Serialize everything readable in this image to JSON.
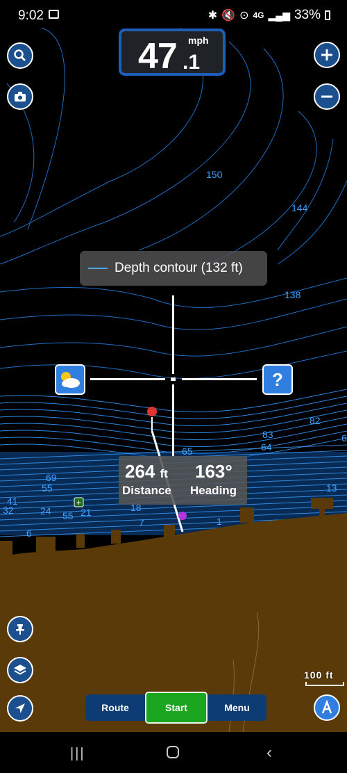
{
  "status": {
    "time": "9:02",
    "battery": "33%",
    "network": "4G",
    "icons": [
      "image-icon",
      "bluetooth-icon",
      "mute-icon",
      "location-icon",
      "signal-icon",
      "battery-icon"
    ]
  },
  "speedometer": {
    "integer": "47",
    "decimal": ".1",
    "unit": "mph"
  },
  "map_labels": {
    "depths": [
      "150",
      "144",
      "138",
      "82",
      "83",
      "64",
      "65",
      "6",
      "69",
      "55",
      "41",
      "32",
      "24",
      "55",
      "21",
      "18",
      "7",
      "6",
      "1",
      "13"
    ]
  },
  "tooltip": {
    "text": "Depth contour  (132 ft)"
  },
  "navigation": {
    "distance_value": "264",
    "distance_unit": "ft",
    "distance_label": "Distance",
    "heading_value": "163°",
    "heading_label": "Heading"
  },
  "bottom_bar": {
    "route": "Route",
    "start": "Start",
    "menu": "Menu"
  },
  "scale": {
    "label": "100 ft"
  },
  "colors": {
    "water": "#000000",
    "contour": "#2a7fd4",
    "land": "#5a3a08",
    "accent": "#1b4f8e",
    "start_green": "#1aa61e"
  }
}
